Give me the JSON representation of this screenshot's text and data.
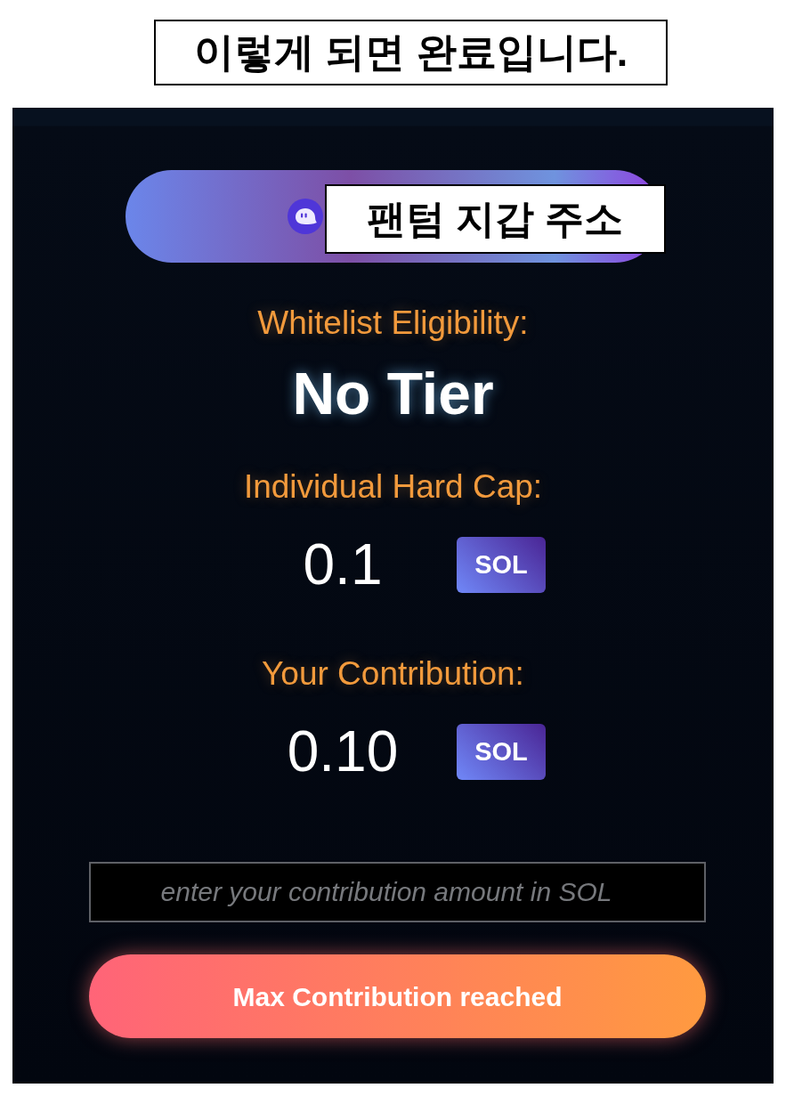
{
  "caption": "이렇게 되면 완료입니다.",
  "wallet_button": {
    "annotation": "팬텀 지갑 주소"
  },
  "eligibility": {
    "label": "Whitelist Eligibility:",
    "value": "No Tier"
  },
  "hard_cap": {
    "label": "Individual Hard Cap:",
    "amount": "0.1",
    "currency": "SOL"
  },
  "contribution": {
    "label": "Your Contribution:",
    "amount": "0.10",
    "currency": "SOL"
  },
  "input": {
    "placeholder": "enter your contribution amount in SOL"
  },
  "submit_button": {
    "label": "Max Contribution reached"
  }
}
